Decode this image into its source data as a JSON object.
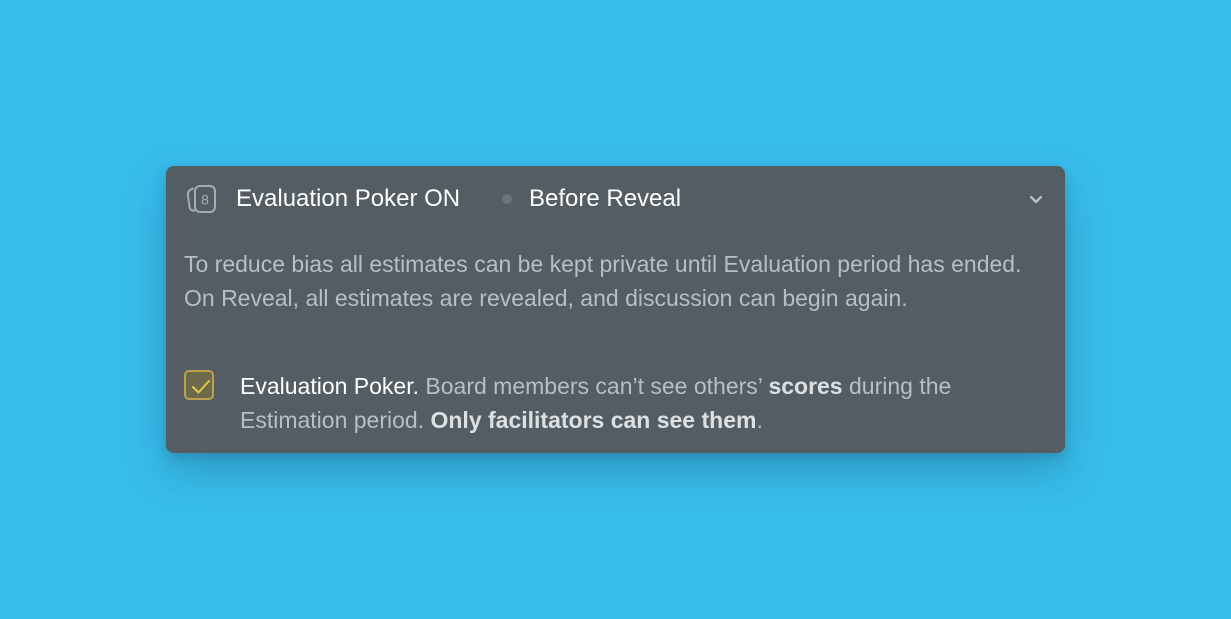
{
  "colors": {
    "background": "#38BDEB",
    "panel": "#545D64",
    "title_text": "#FFFFFF",
    "muted_text": "#B9BEC3",
    "emphasis_text": "#DCE0E3",
    "separator_dot": "#6B747B",
    "icon_stroke": "#A5ACB2",
    "checkbox_fill": "#6D6A4C",
    "checkbox_border": "#BCA24A",
    "checkmark": "#E8C74D"
  },
  "header": {
    "icon": "poker-card-icon",
    "card_number": "8",
    "title": "Evaluation Poker ON",
    "phase": "Before Reveal",
    "toggle_icon": "chevron-down-icon"
  },
  "description": "To reduce bias all estimates can be kept private until Evaluation period has ended. On Reveal, all estimates are revealed, and discussion can begin again.",
  "option": {
    "checked": true,
    "label": "Evaluation Poker.",
    "text_1": " Board members can’t see others’ ",
    "text_bold_1": "scores",
    "text_2": " during the Estimation period. ",
    "text_bold_2": "Only facilitators can see them",
    "text_3": "."
  }
}
